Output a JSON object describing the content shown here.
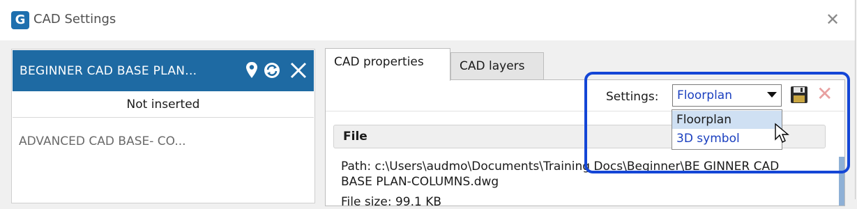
{
  "window": {
    "title": "CAD Settings"
  },
  "left_panel": {
    "selected_item_name": "BEGINNER CAD BASE PLAN...",
    "status": "Not inserted",
    "other_item_name": "ADVANCED CAD BASE- CO..."
  },
  "tabs": [
    {
      "label": "CAD properties",
      "active": true
    },
    {
      "label": "CAD layers",
      "active": false
    }
  ],
  "settings": {
    "label": "Settings:",
    "selected": "Floorplan",
    "options": [
      "Floorplan",
      "3D symbol"
    ]
  },
  "file_section": {
    "header": "File",
    "path_text": "Path: c:\\Users\\audmo\\Documents\\Training Docs\\Beginner\\BE GINNER CAD BASE PLAN-COLUMNS.dwg",
    "size_text": "File size: 99.1 KB"
  },
  "colors": {
    "header_bg": "#1e6aa3",
    "accent_link": "#1a3fbf",
    "highlight_border": "#1446d6"
  },
  "icons": [
    "app-logo-icon",
    "window-close-icon",
    "location-pin-icon",
    "refresh-icon",
    "close-icon",
    "save-floppy-icon",
    "delete-icon",
    "mouse-cursor-icon"
  ]
}
